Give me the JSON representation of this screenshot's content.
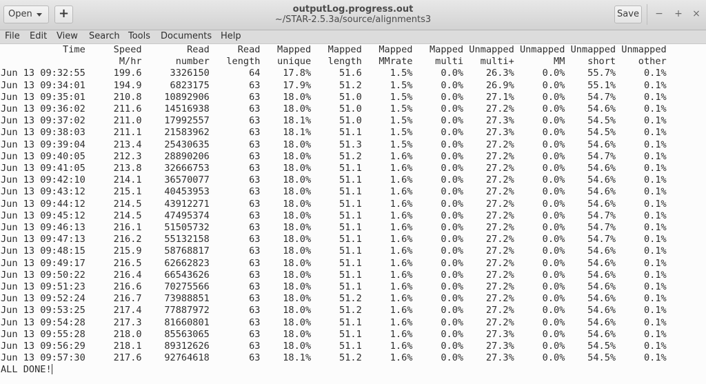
{
  "window": {
    "title": "outputLog.progress.out",
    "subtitle": "~/STAR-2.5.3a/source/alignments3",
    "open_label": "Open",
    "new_label": "+",
    "save_label": "Save",
    "minimize_icon": "−",
    "maximize_icon": "+",
    "close_icon": "×"
  },
  "menu": [
    "File",
    "Edit",
    "View",
    "Search",
    "Tools",
    "Documents",
    "Help"
  ],
  "log": {
    "header1": [
      "Time",
      "Speed",
      "Read",
      "Read",
      "Mapped",
      "Mapped",
      "Mapped",
      "Mapped",
      "Unmapped",
      "Unmapped",
      "Unmapped",
      "Unmapped"
    ],
    "header2": [
      "",
      "M/hr",
      "number",
      "length",
      "unique",
      "length",
      "MMrate",
      "multi",
      "multi+",
      "MM",
      "short",
      "other"
    ],
    "rows": [
      [
        "Jun 13 09:32:55",
        "199.6",
        "3326150",
        "64",
        "17.8%",
        "51.6",
        "1.5%",
        "0.0%",
        "26.3%",
        "0.0%",
        "55.7%",
        "0.1%"
      ],
      [
        "Jun 13 09:34:01",
        "194.9",
        "6823175",
        "63",
        "17.9%",
        "51.2",
        "1.5%",
        "0.0%",
        "26.9%",
        "0.0%",
        "55.1%",
        "0.1%"
      ],
      [
        "Jun 13 09:35:01",
        "210.8",
        "10892906",
        "63",
        "18.0%",
        "51.0",
        "1.5%",
        "0.0%",
        "27.1%",
        "0.0%",
        "54.7%",
        "0.1%"
      ],
      [
        "Jun 13 09:36:02",
        "211.6",
        "14516938",
        "63",
        "18.0%",
        "51.0",
        "1.5%",
        "0.0%",
        "27.2%",
        "0.0%",
        "54.6%",
        "0.1%"
      ],
      [
        "Jun 13 09:37:02",
        "211.0",
        "17992557",
        "63",
        "18.1%",
        "51.0",
        "1.5%",
        "0.0%",
        "27.3%",
        "0.0%",
        "54.5%",
        "0.1%"
      ],
      [
        "Jun 13 09:38:03",
        "211.1",
        "21583962",
        "63",
        "18.1%",
        "51.1",
        "1.5%",
        "0.0%",
        "27.3%",
        "0.0%",
        "54.5%",
        "0.1%"
      ],
      [
        "Jun 13 09:39:04",
        "213.4",
        "25430635",
        "63",
        "18.0%",
        "51.3",
        "1.5%",
        "0.0%",
        "27.2%",
        "0.0%",
        "54.6%",
        "0.1%"
      ],
      [
        "Jun 13 09:40:05",
        "212.3",
        "28890206",
        "63",
        "18.0%",
        "51.2",
        "1.6%",
        "0.0%",
        "27.2%",
        "0.0%",
        "54.7%",
        "0.1%"
      ],
      [
        "Jun 13 09:41:05",
        "213.8",
        "32666753",
        "63",
        "18.0%",
        "51.1",
        "1.6%",
        "0.0%",
        "27.2%",
        "0.0%",
        "54.6%",
        "0.1%"
      ],
      [
        "Jun 13 09:42:10",
        "214.1",
        "36570077",
        "63",
        "18.0%",
        "51.1",
        "1.6%",
        "0.0%",
        "27.2%",
        "0.0%",
        "54.6%",
        "0.1%"
      ],
      [
        "Jun 13 09:43:12",
        "215.1",
        "40453953",
        "63",
        "18.0%",
        "51.1",
        "1.6%",
        "0.0%",
        "27.2%",
        "0.0%",
        "54.6%",
        "0.1%"
      ],
      [
        "Jun 13 09:44:12",
        "214.5",
        "43912271",
        "63",
        "18.0%",
        "51.1",
        "1.6%",
        "0.0%",
        "27.2%",
        "0.0%",
        "54.6%",
        "0.1%"
      ],
      [
        "Jun 13 09:45:12",
        "214.5",
        "47495374",
        "63",
        "18.0%",
        "51.1",
        "1.6%",
        "0.0%",
        "27.2%",
        "0.0%",
        "54.7%",
        "0.1%"
      ],
      [
        "Jun 13 09:46:13",
        "216.1",
        "51505732",
        "63",
        "18.0%",
        "51.1",
        "1.6%",
        "0.0%",
        "27.2%",
        "0.0%",
        "54.7%",
        "0.1%"
      ],
      [
        "Jun 13 09:47:13",
        "216.2",
        "55132158",
        "63",
        "18.0%",
        "51.1",
        "1.6%",
        "0.0%",
        "27.2%",
        "0.0%",
        "54.7%",
        "0.1%"
      ],
      [
        "Jun 13 09:48:15",
        "215.9",
        "58768817",
        "63",
        "18.0%",
        "51.1",
        "1.6%",
        "0.0%",
        "27.2%",
        "0.0%",
        "54.6%",
        "0.1%"
      ],
      [
        "Jun 13 09:49:17",
        "216.5",
        "62662823",
        "63",
        "18.0%",
        "51.1",
        "1.6%",
        "0.0%",
        "27.2%",
        "0.0%",
        "54.6%",
        "0.1%"
      ],
      [
        "Jun 13 09:50:22",
        "216.4",
        "66543626",
        "63",
        "18.0%",
        "51.1",
        "1.6%",
        "0.0%",
        "27.2%",
        "0.0%",
        "54.6%",
        "0.1%"
      ],
      [
        "Jun 13 09:51:23",
        "216.6",
        "70275566",
        "63",
        "18.0%",
        "51.1",
        "1.6%",
        "0.0%",
        "27.2%",
        "0.0%",
        "54.6%",
        "0.1%"
      ],
      [
        "Jun 13 09:52:24",
        "216.7",
        "73988851",
        "63",
        "18.0%",
        "51.2",
        "1.6%",
        "0.0%",
        "27.2%",
        "0.0%",
        "54.6%",
        "0.1%"
      ],
      [
        "Jun 13 09:53:25",
        "217.4",
        "77887972",
        "63",
        "18.0%",
        "51.2",
        "1.6%",
        "0.0%",
        "27.2%",
        "0.0%",
        "54.6%",
        "0.1%"
      ],
      [
        "Jun 13 09:54:28",
        "217.3",
        "81660801",
        "63",
        "18.0%",
        "51.1",
        "1.6%",
        "0.0%",
        "27.2%",
        "0.0%",
        "54.6%",
        "0.1%"
      ],
      [
        "Jun 13 09:55:28",
        "218.0",
        "85563065",
        "63",
        "18.0%",
        "51.1",
        "1.6%",
        "0.0%",
        "27.3%",
        "0.0%",
        "54.6%",
        "0.1%"
      ],
      [
        "Jun 13 09:56:29",
        "218.1",
        "89312626",
        "63",
        "18.0%",
        "51.1",
        "1.6%",
        "0.0%",
        "27.3%",
        "0.0%",
        "54.5%",
        "0.1%"
      ],
      [
        "Jun 13 09:57:30",
        "217.6",
        "92764618",
        "63",
        "18.1%",
        "51.2",
        "1.6%",
        "0.0%",
        "27.3%",
        "0.0%",
        "54.5%",
        "0.1%"
      ]
    ],
    "footer": "ALL DONE!"
  }
}
